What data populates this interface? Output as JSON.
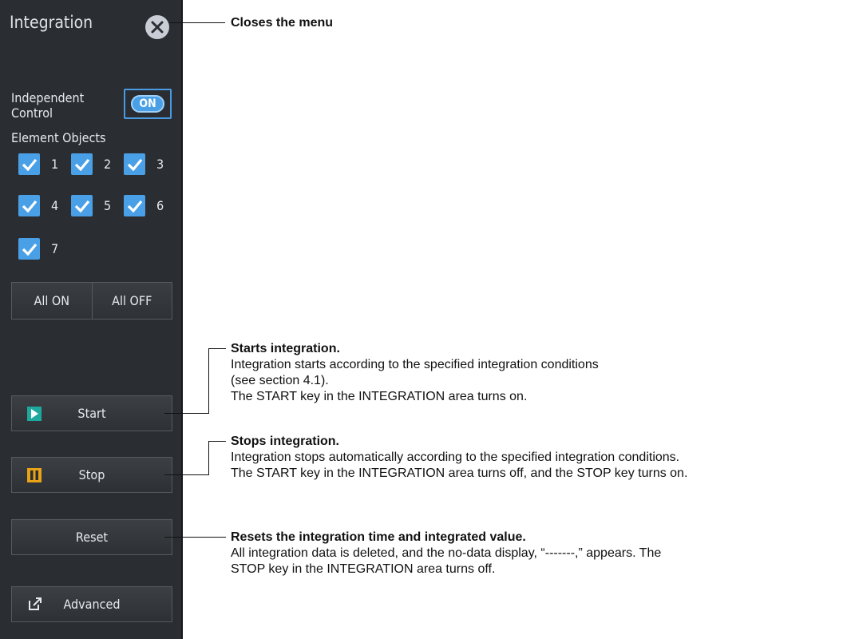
{
  "panel": {
    "title": "Integration",
    "independent_control": {
      "label_line1": "Independent",
      "label_line2": "Control",
      "toggle": "ON"
    },
    "element_objects_label": "Element Objects",
    "elements": [
      {
        "num": "1",
        "checked": true
      },
      {
        "num": "2",
        "checked": true
      },
      {
        "num": "3",
        "checked": true
      },
      {
        "num": "4",
        "checked": true
      },
      {
        "num": "5",
        "checked": true
      },
      {
        "num": "6",
        "checked": true
      },
      {
        "num": "7",
        "checked": true
      }
    ],
    "all_on": "All ON",
    "all_off": "All OFF",
    "start": "Start",
    "stop": "Stop",
    "reset": "Reset",
    "advanced": "Advanced"
  },
  "annotations": {
    "close": "Closes the menu",
    "start": {
      "title": "Starts integration.",
      "line1": "Integration starts according to the specified integration conditions",
      "line2": "(see section 4.1).",
      "line3": "The START key in the INTEGRATION area turns on."
    },
    "stop": {
      "title": "Stops integration.",
      "line1": "Integration stops automatically according to the specified integration conditions.",
      "line2": "The START key in the INTEGRATION area turns off, and the STOP key turns on."
    },
    "reset": {
      "title": "Resets the integration time and integrated value.",
      "line1": "All integration data is deleted, and the no-data display, “-------,” appears. The",
      "line2": "STOP key in the INTEGRATION area turns off."
    }
  },
  "colors": {
    "panel_bg": "#2a2d31",
    "accent": "#4aa0e6",
    "stop_icon": "#e8a317",
    "start_icon": "#1fa89e"
  }
}
